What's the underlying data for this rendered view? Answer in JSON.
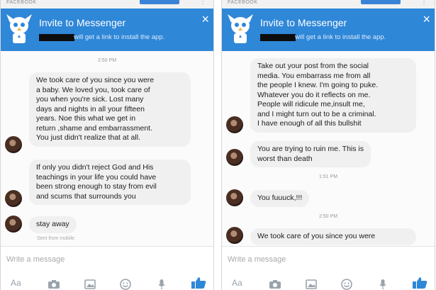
{
  "header": {
    "source_tag": "FACEBOOK",
    "banner_title": "Invite to Messenger",
    "banner_subtitle": "will get a link to install the app.",
    "close_glyph": "×"
  },
  "composer": {
    "placeholder": "Write a message",
    "text_tool": "Aa",
    "icons": [
      "camera-icon",
      "image-icon",
      "emoji-icon",
      "microphone-icon",
      "thumbs-up-icon"
    ]
  },
  "colors": {
    "banner": "#2f87d8",
    "bubble": "#f0f0f0",
    "like": "#2f87d8"
  },
  "left_panel": {
    "timestamp": "2:50 PM",
    "messages": [
      "We took care of you since you were\na baby. We loved you, took care of\nyou when you're sick. Lost many\ndays and nights in all your fifteen\nyears. Noe this what we get in\nreturn ,shame and embarrassment.\nYou just didn't realize that at all.",
      "If only you didn't reject God and His\nteachings in your life you could have\nbeen strong enough to stay from evil\nand scums that surrounds you",
      "stay away"
    ],
    "sent_from": "Sent from mobile"
  },
  "right_panel": {
    "messages": [
      "Take out your post from the social\nmedia. You embarrass me from all\nthe people I knew. I'm going to puke.\nWhatever you do it reflects on me.\nPeople will ridicule me,insult me,\nand I might turn out to be a criminal.\nI have enough of all this bullshit",
      "You are trying to ruin me. This is\nworst than death",
      "You fuuuck,!!!",
      "We took care of you since you were"
    ],
    "timestamps": [
      "1:51 PM",
      "2:50 PM"
    ]
  }
}
